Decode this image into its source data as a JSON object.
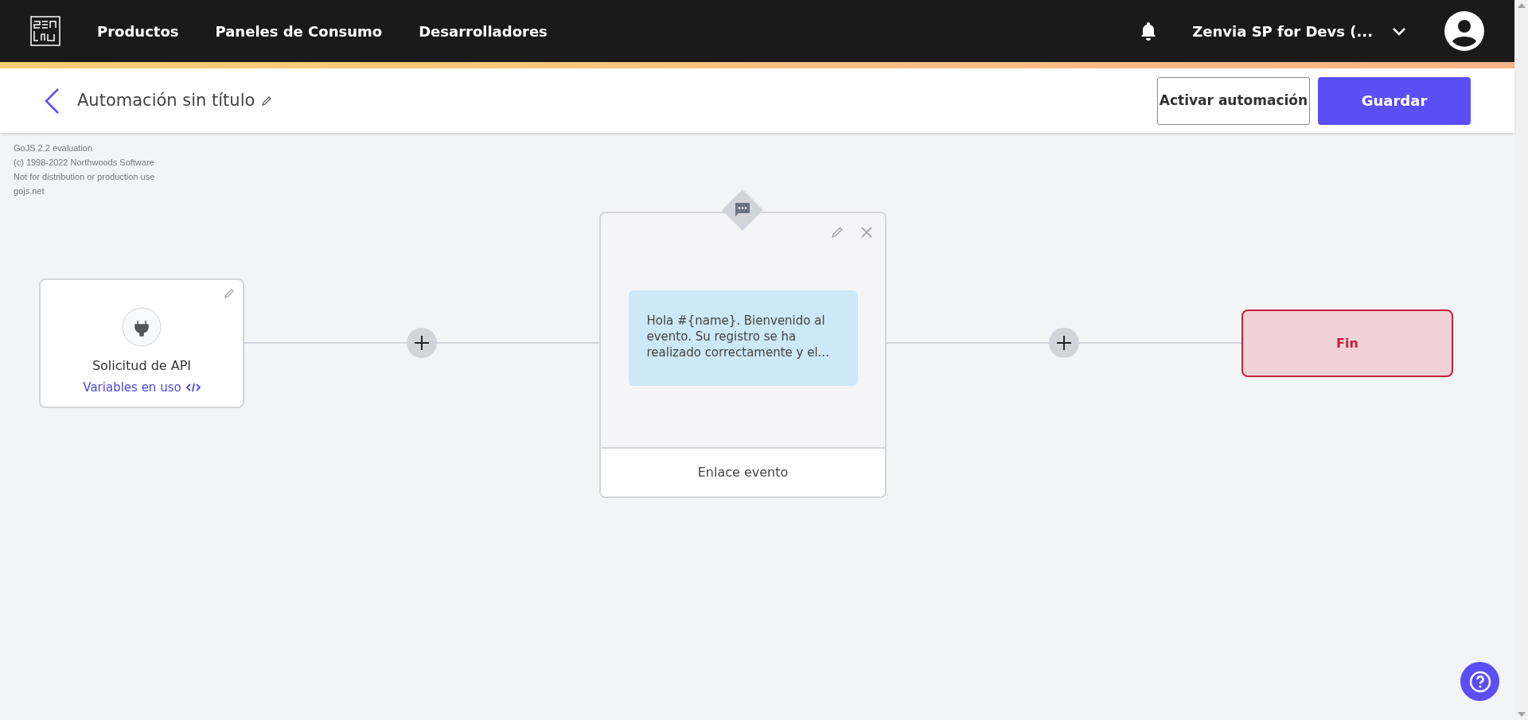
{
  "nav": {
    "items": [
      "Productos",
      "Paneles de Consumo",
      "Desarrolladores"
    ],
    "account": "Zenvia SP for Devs (..."
  },
  "toolbar": {
    "title": "Automación sin título",
    "buttons": [
      {
        "label": "Activar automación",
        "kind": "outline"
      },
      {
        "label": "Guardar",
        "kind": "primary"
      }
    ]
  },
  "canvas": {
    "notice": [
      "GoJS 2.2 evaluation",
      "(c) 1998-2022 Northwoods Software",
      "Not for distribution or production use",
      "gojs.net"
    ],
    "nodes": [
      {
        "kind": "trigger",
        "title": "Solicitud de API",
        "link": "Variables en uso"
      },
      {
        "kind": "message",
        "message": "Hola #{name}. Bienvenido al evento. Su registro se ha realizado correctamente y el...",
        "footer": "Enlace evento"
      },
      {
        "kind": "end",
        "title": "Fin"
      }
    ]
  }
}
